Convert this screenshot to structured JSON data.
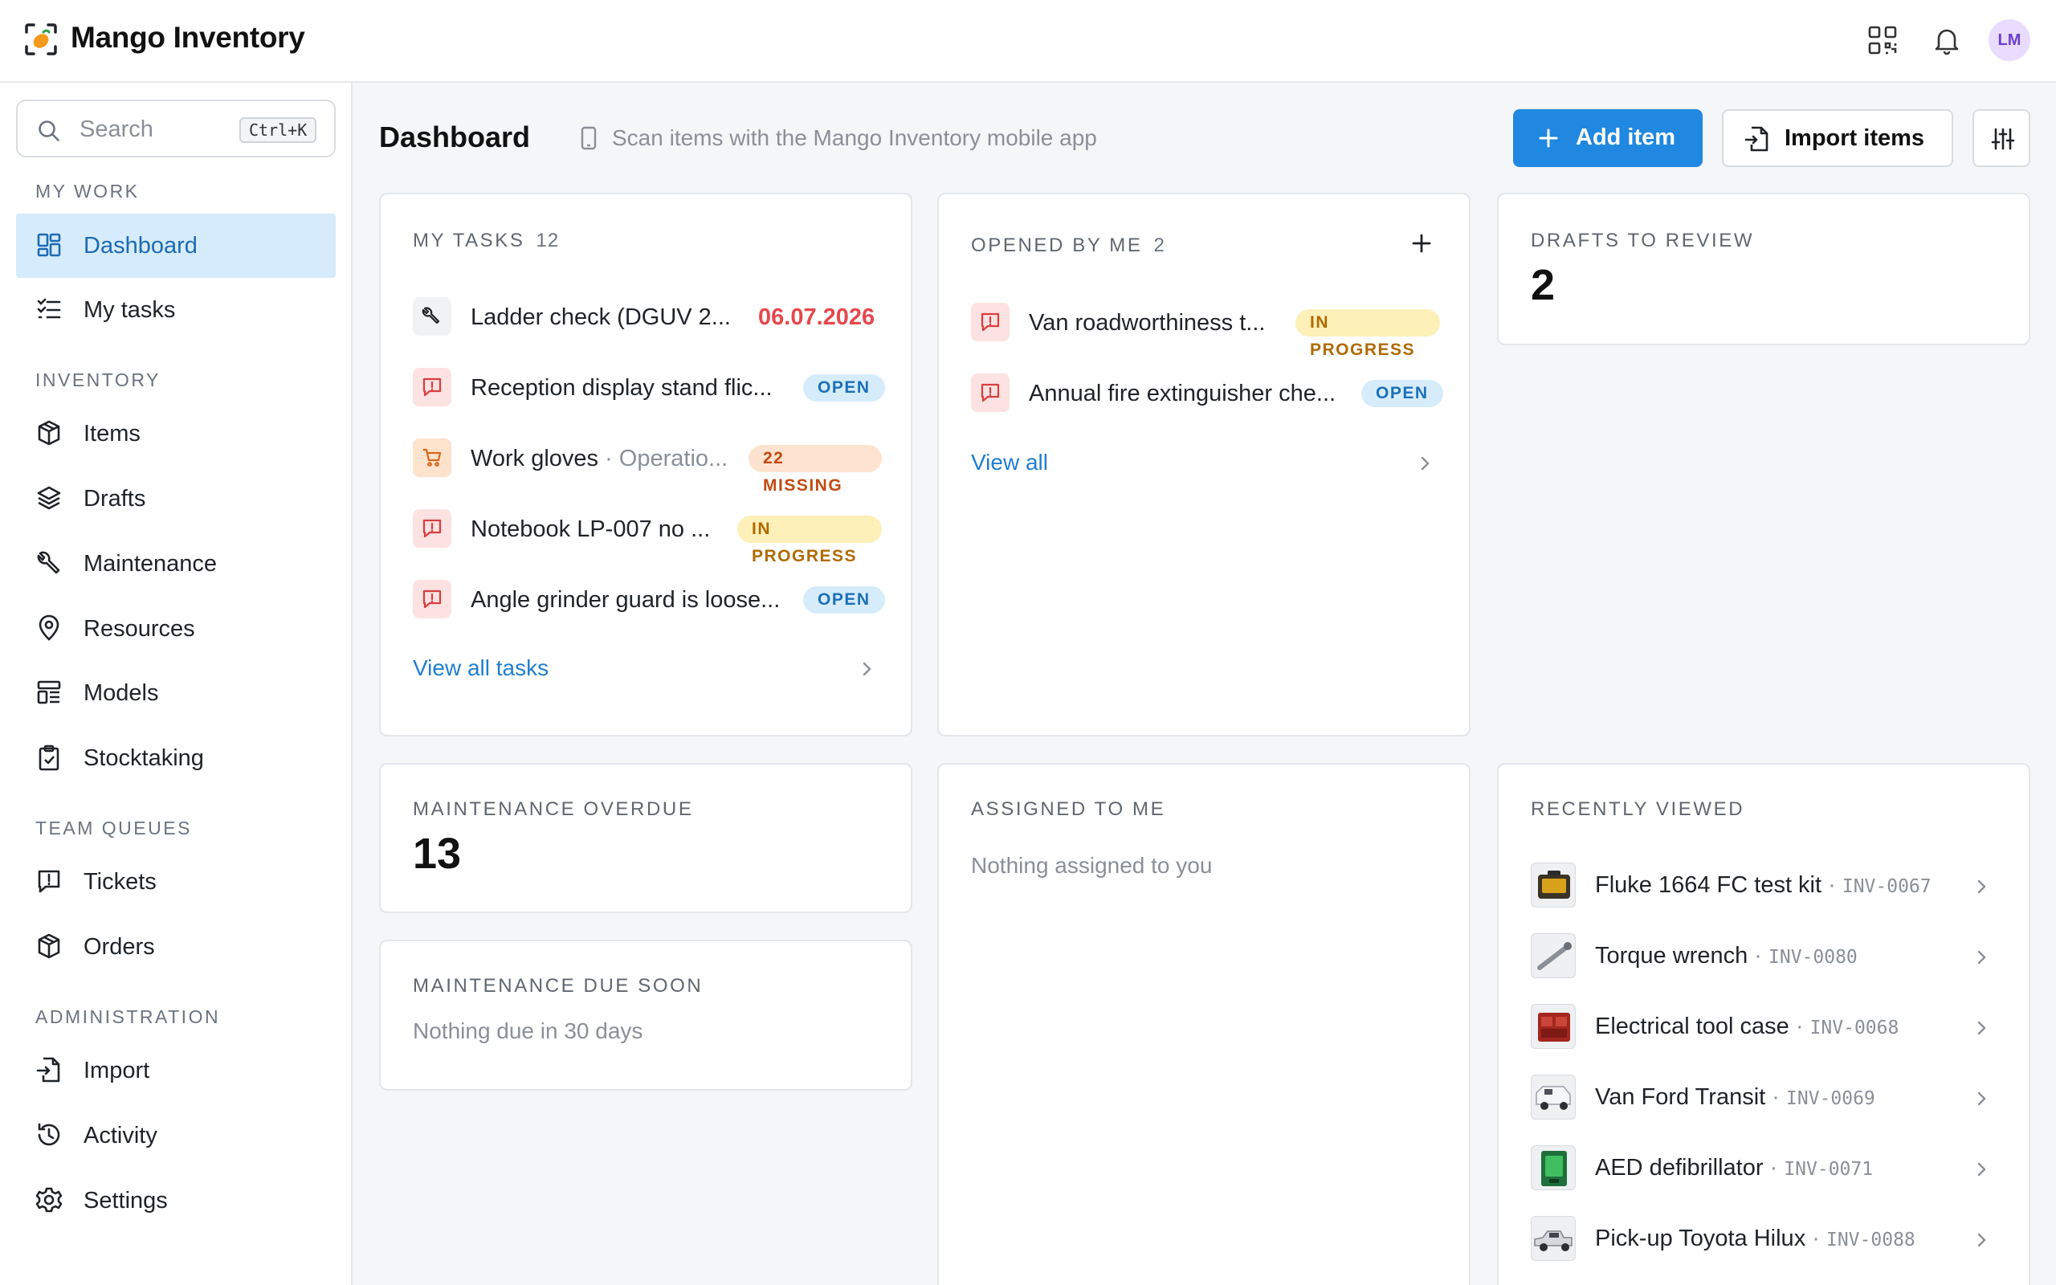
{
  "app": {
    "title": "Mango Inventory",
    "avatar_initials": "LM",
    "accent": "#2088e0"
  },
  "search": {
    "placeholder": "Search",
    "shortcut": "Ctrl+K"
  },
  "sidebar": {
    "sections": [
      {
        "label": "MY WORK"
      },
      {
        "label": "INVENTORY"
      },
      {
        "label": "TEAM QUEUES"
      },
      {
        "label": "ADMINISTRATION"
      }
    ],
    "items": [
      {
        "label": "Dashboard",
        "icon": "dashboard-icon",
        "active": true
      },
      {
        "label": "My tasks",
        "icon": "checklist-icon"
      },
      {
        "label": "Items",
        "icon": "box-icon"
      },
      {
        "label": "Drafts",
        "icon": "layers-icon"
      },
      {
        "label": "Maintenance",
        "icon": "wrench-icon"
      },
      {
        "label": "Resources",
        "icon": "location-pin-icon"
      },
      {
        "label": "Models",
        "icon": "template-icon"
      },
      {
        "label": "Stocktaking",
        "icon": "clipboard-check-icon"
      },
      {
        "label": "Tickets",
        "icon": "chat-alert-icon"
      },
      {
        "label": "Orders",
        "icon": "box-icon"
      },
      {
        "label": "Import",
        "icon": "file-import-icon"
      },
      {
        "label": "Activity",
        "icon": "history-icon"
      },
      {
        "label": "Settings",
        "icon": "gear-icon"
      }
    ]
  },
  "header": {
    "title": "Dashboard",
    "hint": "Scan items with the Mango Inventory mobile app",
    "add_label": "Add item",
    "import_label": "Import items"
  },
  "my_tasks": {
    "title": "MY TASKS",
    "count": "12",
    "rows": [
      {
        "text": "Ladder check (DGUV 2...",
        "date": "06.07.2026",
        "icon": "wrench-icon"
      },
      {
        "text": "Reception display stand flic...",
        "badge": "OPEN",
        "icon": "chat-alert-icon"
      },
      {
        "text": "Work gloves",
        "sub": " · Operatio...",
        "badge": "22 MISSING",
        "icon": "cart-icon"
      },
      {
        "text": "Notebook LP-007 no ...",
        "badge": "IN PROGRESS",
        "icon": "chat-alert-icon"
      },
      {
        "text": "Angle grinder guard is loose...",
        "badge": "OPEN",
        "icon": "chat-alert-icon"
      }
    ],
    "link": "View all tasks"
  },
  "opened_by_me": {
    "title": "OPENED BY ME",
    "count": "2",
    "rows": [
      {
        "text": "Van roadworthiness t...",
        "badge": "IN PROGRESS"
      },
      {
        "text": "Annual fire extinguisher che...",
        "badge": "OPEN"
      }
    ],
    "link": "View all"
  },
  "drafts": {
    "title": "DRAFTS TO REVIEW",
    "value": "2"
  },
  "maint_overdue": {
    "title": "MAINTENANCE OVERDUE",
    "value": "13"
  },
  "maint_soon": {
    "title": "MAINTENANCE DUE SOON",
    "empty": "Nothing due in 30 days"
  },
  "assigned": {
    "title": "ASSIGNED TO ME",
    "empty": "Nothing assigned to you"
  },
  "recent": {
    "title": "RECENTLY VIEWED",
    "items": [
      {
        "name": "Fluke 1664 FC test kit",
        "sep": " · ",
        "code": "INV-0067"
      },
      {
        "name": "Torque wrench",
        "sep": " · ",
        "code": "INV-0080"
      },
      {
        "name": "Electrical tool case",
        "sep": " · ",
        "code": "INV-0068"
      },
      {
        "name": "Van Ford Transit",
        "sep": " · ",
        "code": "INV-0069"
      },
      {
        "name": "AED defibrillator",
        "sep": " · ",
        "code": "INV-0071"
      },
      {
        "name": "Pick-up Toyota Hilux",
        "sep": " · ",
        "code": "INV-0088"
      }
    ]
  }
}
